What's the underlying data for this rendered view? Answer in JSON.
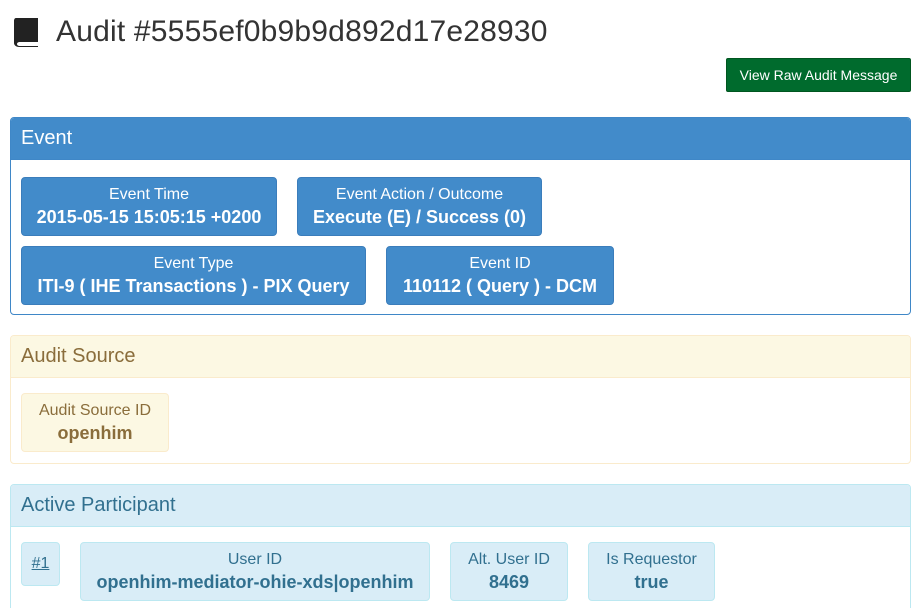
{
  "page": {
    "title": "Audit #5555ef0b9b9d892d17e28930",
    "title_icon": "book-icon"
  },
  "toolbar": {
    "raw_button_label": "View Raw Audit Message"
  },
  "event_panel": {
    "heading": "Event",
    "tiles": [
      {
        "label": "Event Time",
        "value": "2015-05-15 15:05:15 +0200"
      },
      {
        "label": "Event Action / Outcome",
        "value": "Execute (E) / Success (0)"
      },
      {
        "label": "Event Type",
        "value": "ITI-9 ( IHE Transactions ) - PIX Query"
      },
      {
        "label": "Event ID",
        "value": "110112 ( Query ) - DCM"
      }
    ]
  },
  "source_panel": {
    "heading": "Audit Source",
    "tiles": [
      {
        "label": "Audit Source ID",
        "value": "openhim"
      }
    ]
  },
  "participant_panel": {
    "heading": "Active Participant",
    "participants": [
      {
        "index_link": "#1",
        "tiles": [
          {
            "label": "User ID",
            "value": "openhim-mediator-ohie-xds|openhim"
          },
          {
            "label": "Alt. User ID",
            "value": "8469"
          },
          {
            "label": "Is Requestor",
            "value": "true"
          }
        ]
      }
    ]
  },
  "colors": {
    "primary": "#428bca",
    "success": "#006b2d",
    "warning_bg": "#fcf8e3",
    "warning_text": "#8a6d3b",
    "info_bg": "#d9edf7",
    "info_text": "#31708f"
  }
}
